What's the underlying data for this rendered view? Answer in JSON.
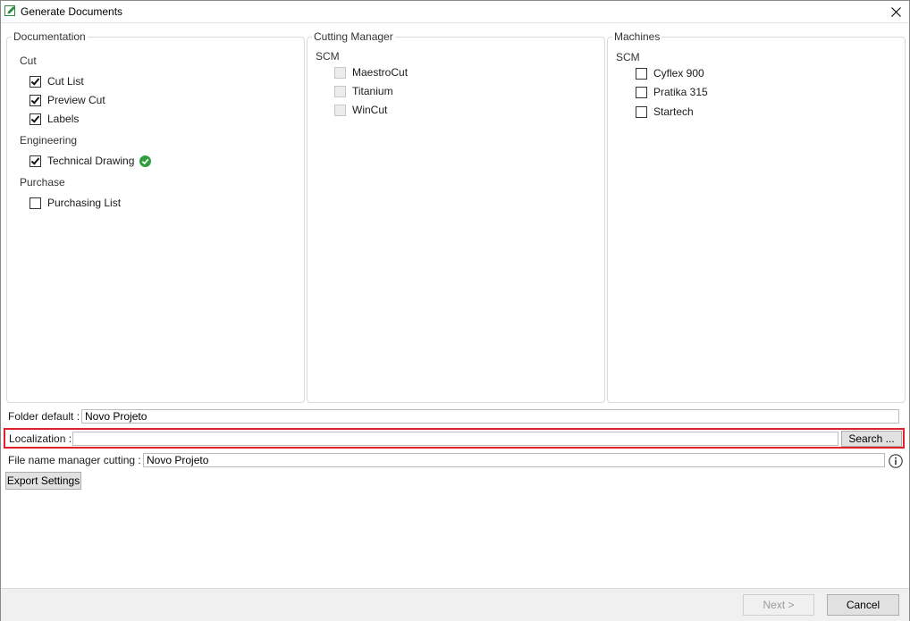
{
  "window": {
    "title": "Generate Documents"
  },
  "documentation": {
    "legend": "Documentation",
    "groups": [
      {
        "label": "Cut",
        "items": [
          {
            "label": "Cut List",
            "checked": true
          },
          {
            "label": "Preview Cut",
            "checked": true
          },
          {
            "label": "Labels",
            "checked": true
          }
        ]
      },
      {
        "label": "Engineering",
        "items": [
          {
            "label": "Technical Drawing",
            "checked": true,
            "status": "ok-icon"
          }
        ]
      },
      {
        "label": "Purchase",
        "items": [
          {
            "label": "Purchasing List",
            "checked": false
          }
        ]
      }
    ]
  },
  "cutting_manager": {
    "legend": "Cutting Manager",
    "group": "SCM",
    "items": [
      {
        "label": "MaestroCut",
        "checked": false,
        "disabled": true
      },
      {
        "label": "Titanium",
        "checked": false,
        "disabled": true
      },
      {
        "label": "WinCut",
        "checked": false,
        "disabled": true
      }
    ]
  },
  "machines": {
    "legend": "Machines",
    "group": "SCM",
    "items": [
      {
        "label": "Cyflex 900",
        "checked": false
      },
      {
        "label": "Pratika 315",
        "checked": false
      },
      {
        "label": "Startech",
        "checked": false
      }
    ]
  },
  "fields": {
    "folder_default": {
      "label": "Folder default :",
      "value": "Novo Projeto"
    },
    "localization": {
      "label": "Localization :",
      "value": "",
      "search_label": "Search ..."
    },
    "file_name": {
      "label": "File name manager cutting :",
      "value": "Novo Projeto"
    }
  },
  "buttons": {
    "export_settings": "Export Settings",
    "next": "Next >",
    "cancel": "Cancel"
  },
  "colors": {
    "highlight": "#e0202a",
    "ok_green": "#2e9e3e",
    "info_blue": "#1f5fa8"
  }
}
